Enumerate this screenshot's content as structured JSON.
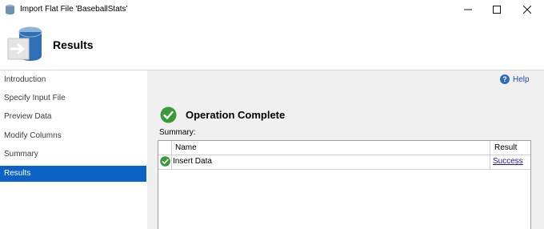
{
  "window": {
    "title": "Import Flat File 'BaseballStats'",
    "controls": [
      "minimize",
      "maximize",
      "close"
    ]
  },
  "header": {
    "title": "Results",
    "icon": "database-import-icon"
  },
  "nav": {
    "items": [
      {
        "label": "Introduction",
        "active": false
      },
      {
        "label": "Specify Input File",
        "active": false
      },
      {
        "label": "Preview Data",
        "active": false
      },
      {
        "label": "Modify Columns",
        "active": false
      },
      {
        "label": "Summary",
        "active": false
      },
      {
        "label": "Results",
        "active": true
      }
    ]
  },
  "content": {
    "help_label": "Help",
    "status": "Operation Complete",
    "summary_label": "Summary:",
    "table": {
      "columns": [
        "Name",
        "Result"
      ],
      "rows": [
        {
          "name": "Insert Data",
          "result": "Success",
          "status_icon": "check-icon"
        }
      ]
    }
  },
  "colors": {
    "nav_active": "#0b63c5",
    "content_bg": "#f0f0f0",
    "success_green": "#3a9a3a",
    "link": "#1a1aa6"
  }
}
